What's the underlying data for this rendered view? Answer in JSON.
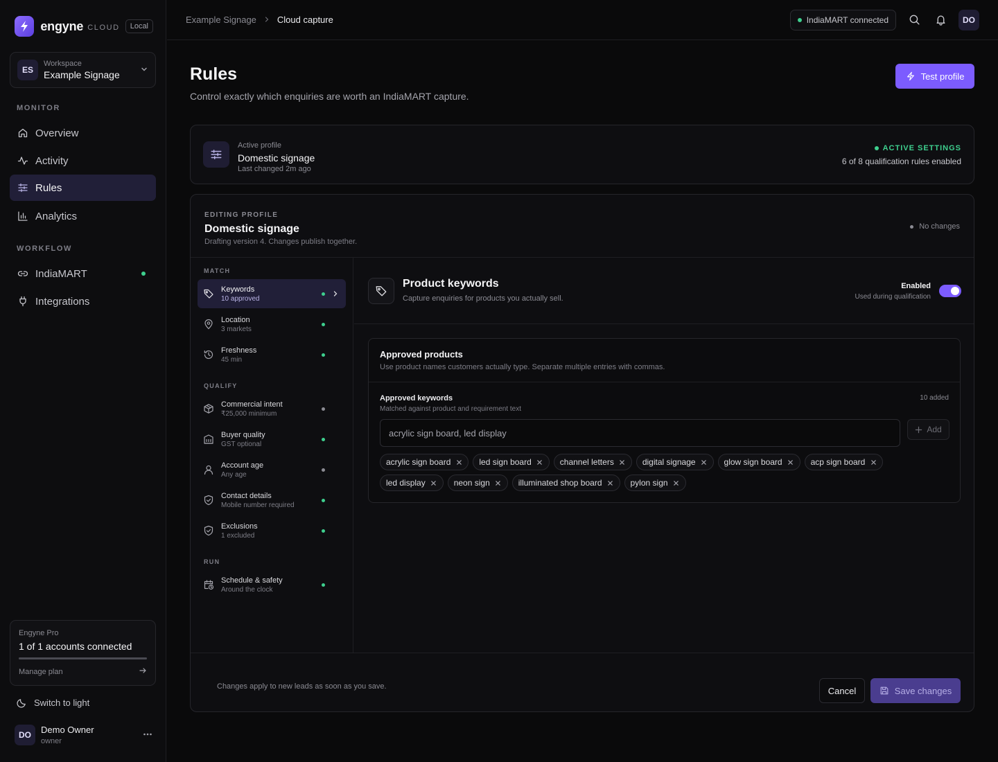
{
  "brand": {
    "name": "engyne",
    "tag": "CLOUD",
    "env": "Local",
    "accent": "#7c5cff"
  },
  "workspace": {
    "initials": "ES",
    "label": "Workspace",
    "name": "Example Signage"
  },
  "nav": {
    "monitor_label": "MONITOR",
    "workflow_label": "WORKFLOW",
    "items": [
      {
        "label": "Overview",
        "icon": "home-icon"
      },
      {
        "label": "Activity",
        "icon": "activity-icon"
      },
      {
        "label": "Rules",
        "icon": "sliders-icon",
        "active": true
      },
      {
        "label": "Analytics",
        "icon": "bar-chart-icon"
      },
      {
        "label": "IndiaMART",
        "icon": "link-icon",
        "status": "connected"
      },
      {
        "label": "Integrations",
        "icon": "plug-icon"
      }
    ]
  },
  "plan": {
    "title": "Engyne Pro",
    "summary": "1 of 1 accounts connected",
    "usage_fraction": 1.0,
    "link": "Manage plan"
  },
  "theme_toggle": "Switch to light",
  "user": {
    "initials": "DO",
    "name": "Demo Owner",
    "role": "owner"
  },
  "breadcrumb": {
    "parent": "Example Signage",
    "current": "Cloud capture"
  },
  "topbar": {
    "connection": "IndiaMART connected",
    "avatar": "DO"
  },
  "page": {
    "title": "Rules",
    "subtitle": "Control exactly which enquiries are worth an IndiaMART capture.",
    "test_button": "Test profile"
  },
  "active_profile": {
    "label": "Active profile",
    "name": "Domestic signage",
    "changed": "Last changed 2m ago",
    "status": "ACTIVE SETTINGS",
    "rules_count": "6 of 8 qualification rules enabled"
  },
  "editor": {
    "kicker": "EDITING PROFILE",
    "title": "Domestic signage",
    "subtitle": "Drafting version 4. Changes publish together.",
    "state": "No changes",
    "sections": {
      "match": "MATCH",
      "qualify": "QUALIFY",
      "run": "RUN"
    },
    "rules": [
      {
        "name": "Keywords",
        "sub": "10 approved",
        "icon": "tag-icon",
        "enabled": true,
        "active": true
      },
      {
        "name": "Location",
        "sub": "3 markets",
        "icon": "map-pin-icon",
        "enabled": true
      },
      {
        "name": "Freshness",
        "sub": "45 min",
        "icon": "history-icon",
        "enabled": true
      },
      {
        "name": "Commercial intent",
        "sub": "₹25,000 minimum",
        "icon": "box-icon",
        "enabled": false
      },
      {
        "name": "Buyer quality",
        "sub": "GST optional",
        "icon": "building-icon",
        "enabled": true
      },
      {
        "name": "Account age",
        "sub": "Any age",
        "icon": "user-icon",
        "enabled": false
      },
      {
        "name": "Contact details",
        "sub": "Mobile number required",
        "icon": "shield-check-icon",
        "enabled": true
      },
      {
        "name": "Exclusions",
        "sub": "1 excluded",
        "icon": "shield-icon",
        "enabled": true
      },
      {
        "name": "Schedule & safety",
        "sub": "Around the clock",
        "icon": "calendar-clock-icon",
        "enabled": true
      }
    ],
    "detail": {
      "title": "Product keywords",
      "subtitle": "Capture enquiries for products you actually sell.",
      "enabled_label": "Enabled",
      "enabled_sub": "Used during qualification",
      "enabled": true,
      "card_title": "Approved products",
      "card_sub": "Use product names customers actually type. Separate multiple entries with commas.",
      "keywords_title": "Approved keywords",
      "keywords_sub": "Matched against product and requirement text",
      "keywords_count": "10 added",
      "input_placeholder": "acrylic sign board, led display",
      "add_button": "Add",
      "keywords": [
        "acrylic sign board",
        "led sign board",
        "channel letters",
        "digital signage",
        "glow sign board",
        "acp sign board",
        "led display",
        "neon sign",
        "illuminated shop board",
        "pylon sign"
      ]
    },
    "footer_note": "Changes apply to new leads as soon as you save.",
    "cancel": "Cancel",
    "save": "Save changes"
  },
  "colors": {
    "success": "#3ecf8e",
    "muted_dot": "#8b8b93",
    "accent": "#7c5cff"
  }
}
